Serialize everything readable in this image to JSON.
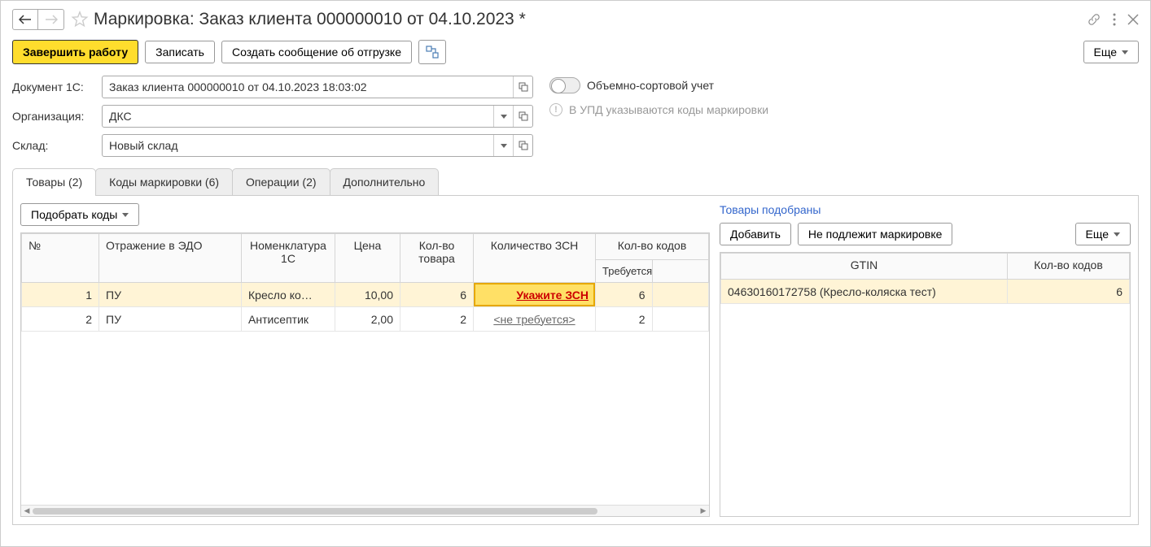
{
  "title": "Маркировка: Заказ клиента 000000010 от 04.10.2023 *",
  "toolbar": {
    "finish": "Завершить работу",
    "write": "Записать",
    "create_msg": "Создать сообщение об отгрузке",
    "more": "Еще"
  },
  "form": {
    "doc_label": "Документ 1С:",
    "doc_value": "Заказ клиента 000000010 от 04.10.2023 18:03:02",
    "org_label": "Организация:",
    "org_value": "ДКС",
    "sklad_label": "Склад:",
    "sklad_value": "Новый склад",
    "toggle_label": "Объемно-сортовой учет",
    "info_text": "В УПД указываются коды маркировки"
  },
  "tabs": {
    "t1": "Товары (2)",
    "t2": "Коды маркировки (6)",
    "t3": "Операции (2)",
    "t4": "Дополнительно"
  },
  "left": {
    "pick_codes": "Подобрать коды",
    "headers": {
      "no": "№",
      "edo": "Отражение в ЭДО",
      "nom": "Номенклатура 1С",
      "price": "Цена",
      "qty": "Кол-во товара",
      "zsn": "Количество ЗСН",
      "codes": "Кол-во кодов",
      "req": "Требуется"
    },
    "rows": [
      {
        "no": "1",
        "edo": "ПУ",
        "nom": "Кресло ко…",
        "price": "10,00",
        "qty": "6",
        "zsn": "Укажите ЗСН",
        "zsn_active": true,
        "req": "6"
      },
      {
        "no": "2",
        "edo": "ПУ",
        "nom": "Антисептик",
        "price": "2,00",
        "qty": "2",
        "zsn": "<не требуется>",
        "zsn_active": false,
        "req": "2"
      }
    ]
  },
  "right": {
    "title": "Товары подобраны",
    "add": "Добавить",
    "no_mark": "Не подлежит маркировке",
    "more": "Еще",
    "headers": {
      "gtin": "GTIN",
      "qty": "Кол-во кодов"
    },
    "rows": [
      {
        "gtin": "04630160172758 (Кресло-коляска тест)",
        "qty": "6"
      }
    ]
  }
}
